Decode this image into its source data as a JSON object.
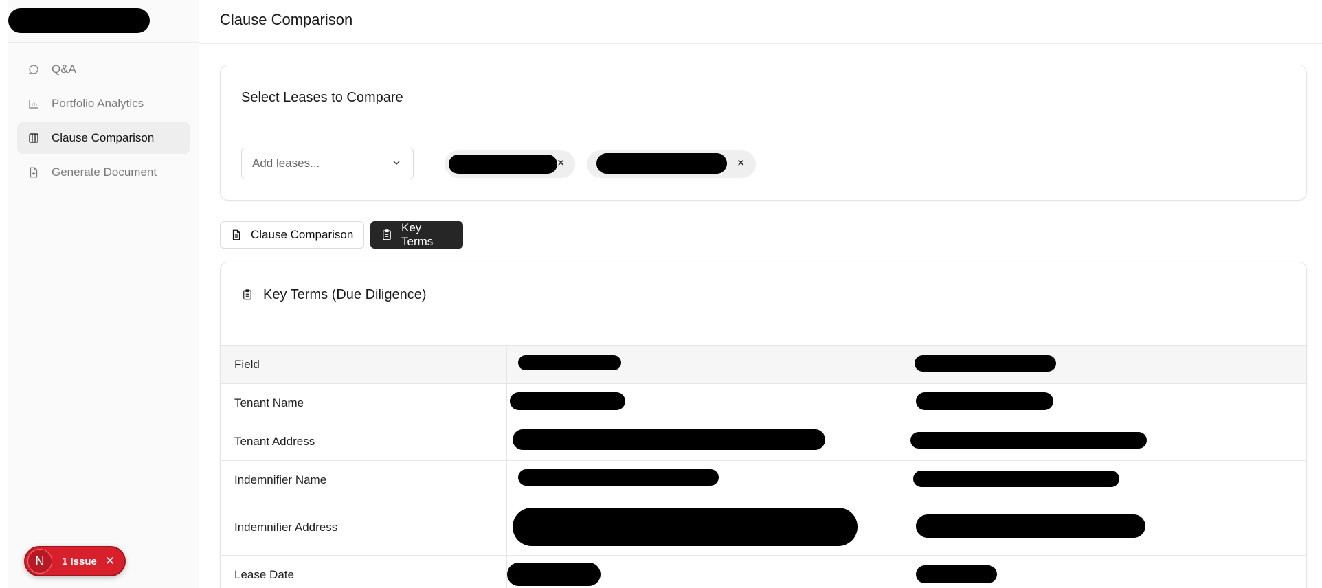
{
  "sidebar": {
    "items": [
      {
        "label": "Q&A",
        "icon": "chat-icon",
        "active": false
      },
      {
        "label": "Portfolio Analytics",
        "icon": "bar-chart-icon",
        "active": false
      },
      {
        "label": "Clause Comparison",
        "icon": "columns-icon",
        "active": true
      },
      {
        "label": "Generate Document",
        "icon": "file-plus-icon",
        "active": false
      }
    ],
    "issue_badge": {
      "letter": "N",
      "label": "1 Issue",
      "close": "✕"
    }
  },
  "header": {
    "title": "Clause Comparison"
  },
  "select_card": {
    "title": "Select Leases to Compare",
    "placeholder": "Add leases...",
    "chip_close": "×"
  },
  "tabs": [
    {
      "label": "Clause Comparison",
      "active": false
    },
    {
      "label": "Key Terms",
      "active": true
    }
  ],
  "key_terms": {
    "title": "Key Terms (Due Diligence)",
    "rows": [
      "Field",
      "Tenant Name",
      "Tenant Address",
      "Indemnifier Name",
      "Indemnifier Address",
      "Lease Date"
    ]
  },
  "colors": {
    "accent_dark": "#262626",
    "issue_red": "#d8202d",
    "active_nav_bg": "#eeeeee"
  }
}
